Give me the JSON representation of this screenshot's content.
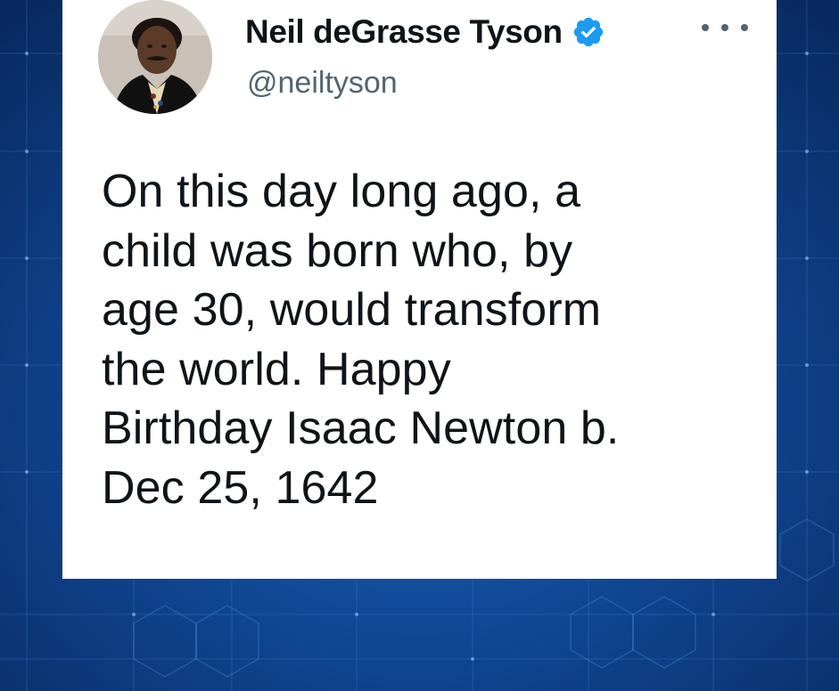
{
  "author": {
    "display_name": "Neil deGrasse Tyson",
    "handle": "@neiltyson",
    "verified": true,
    "avatar_icon": "profile-photo"
  },
  "menu": {
    "icon": "more-options-icon"
  },
  "tweet": {
    "lines": [
      "On this day long ago, a",
      "child was born who, by",
      "age 30, would transform",
      "the world. Happy",
      "Birthday Isaac Newton b.",
      "Dec 25, 1642"
    ]
  },
  "colors": {
    "background": "#0d3f86",
    "card": "#ffffff",
    "text": "#0f1419",
    "secondary_text": "#536471",
    "verified_badge": "#1d9bf0"
  }
}
